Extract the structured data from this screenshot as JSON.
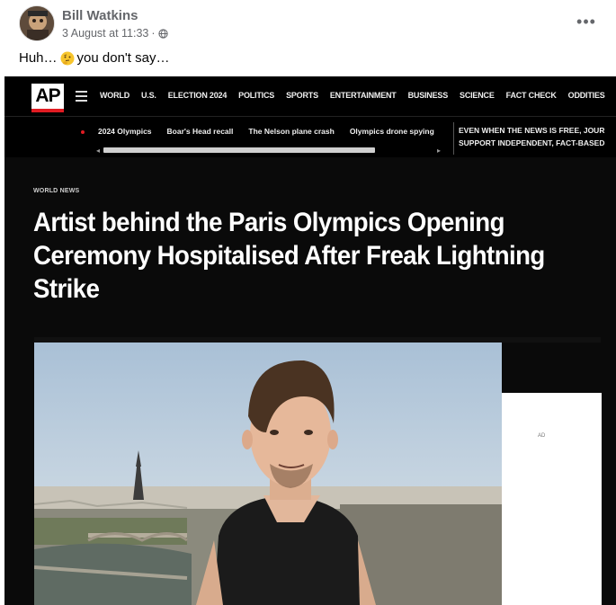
{
  "post": {
    "author": "Bill Watkins",
    "timestamp": "3 August at 11:33",
    "separator": "·",
    "privacy_icon": "globe-icon",
    "more_label": "•••",
    "caption_before": "Huh…",
    "caption_emoji": "thinking-face-emoji",
    "caption_after": " you don't say…"
  },
  "screenshot": {
    "logo_text": "AP",
    "nav_items": [
      "WORLD",
      "U.S.",
      "ELECTION 2024",
      "POLITICS",
      "SPORTS",
      "ENTERTAINMENT",
      "BUSINESS",
      "SCIENCE",
      "FACT CHECK",
      "ODDITIES"
    ],
    "trending_items": [
      "2024 Olympics",
      "Boar's Head recall",
      "The Nelson plane crash",
      "Olympics drone spying"
    ],
    "promo_line1": "EVEN WHEN THE NEWS IS FREE, JOUR",
    "promo_line2": "SUPPORT INDEPENDENT, FACT-BASED",
    "section_label": "WORLD NEWS",
    "headline": "Artist behind the Paris Olympics Opening Ceremony Hospitalised After Freak Lightning Strike",
    "panel_label": "AD"
  },
  "colors": {
    "ap_red": "#e11b22",
    "meta_grey": "#65676b",
    "page_black": "#0a0a0a"
  }
}
